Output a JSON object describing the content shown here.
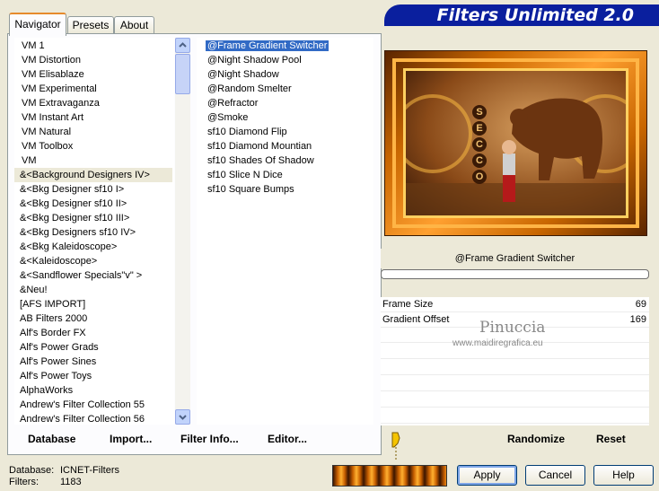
{
  "banner_title": "Filters Unlimited 2.0",
  "tabs": [
    {
      "label": "Navigator",
      "active": true
    },
    {
      "label": "Presets",
      "active": false
    },
    {
      "label": "About",
      "active": false
    }
  ],
  "categories": [
    "VM 1",
    "VM Distortion",
    "VM Elisablaze",
    "VM Experimental",
    "VM Extravaganza",
    "VM Instant Art",
    "VM Natural",
    "VM Toolbox",
    "VM",
    "&<Background Designers IV>",
    "&<Bkg Designer sf10 I>",
    "&<Bkg Designer sf10 II>",
    "&<Bkg Designer sf10 III>",
    "&<Bkg Designers sf10 IV>",
    "&<Bkg Kaleidoscope>",
    "&<Kaleidoscope>",
    "&<Sandflower Specials\"v\" >",
    "&Neu!",
    "[AFS IMPORT]",
    "AB Filters 2000",
    "Alf's Border FX",
    "Alf's Power Grads",
    "Alf's Power Sines",
    "Alf's Power Toys",
    "AlphaWorks",
    "Andrew's Filter Collection 55",
    "Andrew's Filter Collection 56"
  ],
  "selected_category_index": 9,
  "filters": [
    "@Frame Gradient Switcher",
    "@Night Shadow Pool",
    "@Night Shadow",
    "@Random Smelter",
    "@Refractor",
    "@Smoke",
    "sf10 Diamond Flip",
    "sf10 Diamond Mountian",
    "sf10 Shades Of Shadow",
    "sf10 Slice N Dice",
    "sf10 Square Bumps"
  ],
  "selected_filter_index": 0,
  "preview_text": "SECCO",
  "current_filter": "@Frame Gradient Switcher",
  "params": [
    {
      "label": "Frame Size",
      "value": "69"
    },
    {
      "label": "Gradient Offset",
      "value": "169"
    }
  ],
  "watermark": {
    "name": "Pinuccia",
    "url": "www.maidiregrafica.eu"
  },
  "left_buttons": {
    "database": "Database",
    "import": "Import...",
    "filter_info": "Filter Info...",
    "editor": "Editor..."
  },
  "right_buttons": {
    "randomize": "Randomize",
    "reset": "Reset"
  },
  "status": {
    "database_label": "Database:",
    "database_value": "ICNET-Filters",
    "filters_label": "Filters:",
    "filters_value": "1183"
  },
  "dialog_buttons": {
    "apply": "Apply",
    "cancel": "Cancel",
    "help": "Help"
  }
}
